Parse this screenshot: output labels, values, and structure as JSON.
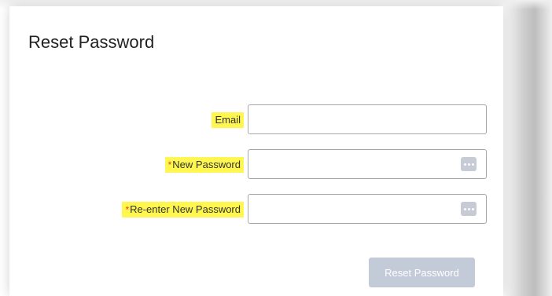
{
  "dialog": {
    "title": "Reset Password"
  },
  "form": {
    "email": {
      "label": "Email",
      "value": "",
      "placeholder": ""
    },
    "new_password": {
      "required_marker": "*",
      "label": "New Password",
      "value": "",
      "placeholder": "",
      "reveal_icon": "dots-icon"
    },
    "reenter_password": {
      "required_marker": "*",
      "label": "Re-enter New Password",
      "value": "",
      "placeholder": "",
      "reveal_icon": "dots-icon"
    },
    "submit_label": "Reset Password"
  },
  "colors": {
    "label_highlight": "#fff64f",
    "required_marker": "#e23b2e",
    "button_disabled": "#c3cad8"
  }
}
